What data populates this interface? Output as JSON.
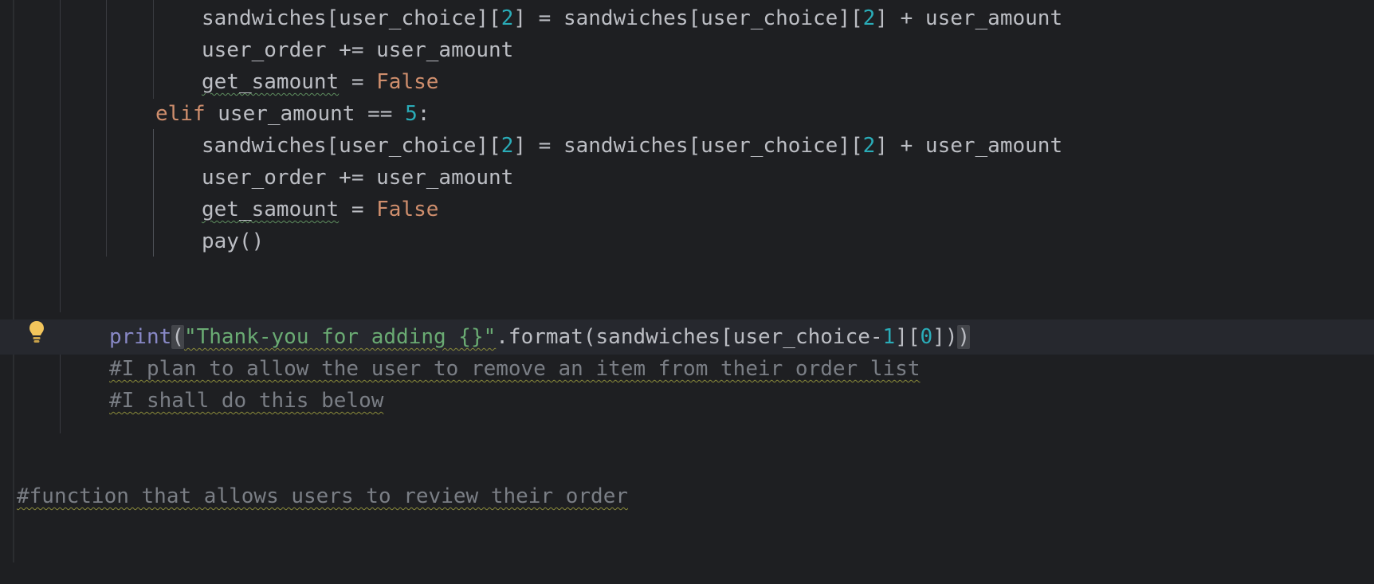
{
  "editor": {
    "lines": [
      {
        "id": "l1",
        "parts": [
          "sandwiches[user_choice][",
          "2",
          "] = sandwiches[user_choice][",
          "2",
          "] + user_amount"
        ]
      },
      {
        "id": "l2",
        "text": "user_order += user_amount"
      },
      {
        "id": "l3",
        "parts": [
          "get_samount",
          " = ",
          "False"
        ]
      },
      {
        "id": "l4",
        "parts": [
          "elif",
          " user_amount == ",
          "5",
          ":"
        ]
      },
      {
        "id": "l5",
        "parts": [
          "sandwiches[user_choice][",
          "2",
          "] = sandwiches[user_choice][",
          "2",
          "] + user_amount"
        ]
      },
      {
        "id": "l6",
        "text": "user_order += user_amount"
      },
      {
        "id": "l7",
        "parts": [
          "get_samount",
          " = ",
          "False"
        ]
      },
      {
        "id": "l8",
        "text": "pay()"
      },
      {
        "id": "l9",
        "parts": [
          "print",
          "(",
          "\"Thank-you for adding {}\"",
          ".format(sandwiches[user_choice-",
          "1",
          "][",
          "0",
          "])",
          ")"
        ]
      },
      {
        "id": "l10",
        "text": "#I plan to allow the user to remove an item from their order list"
      },
      {
        "id": "l11",
        "text": "#I shall do this below"
      },
      {
        "id": "l12",
        "text": "#function that allows users to review their order"
      }
    ]
  },
  "icons": {
    "intention_bulb": "lightbulb-icon",
    "bulb_color": "#f2c55c"
  },
  "colors": {
    "background": "#1e1f22",
    "keyword": "#cf8e6d",
    "number": "#2aacb8",
    "string": "#6aab73",
    "builtin": "#8888c6",
    "comment": "#7a7e85",
    "text": "#bcbec4"
  }
}
